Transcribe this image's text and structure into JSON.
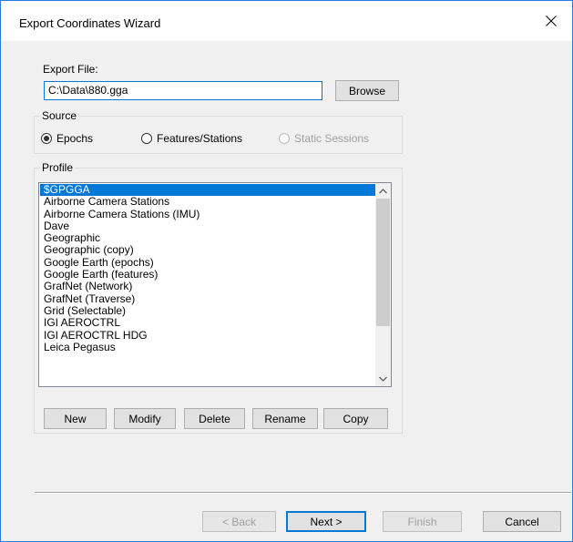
{
  "window": {
    "title": "Export Coordinates Wizard"
  },
  "export_file": {
    "label": "Export File:",
    "value": "C:\\Data\\880.gga",
    "browse_label": "Browse"
  },
  "source": {
    "title": "Source",
    "options": [
      {
        "label": "Epochs",
        "checked": true,
        "enabled": true
      },
      {
        "label": "Features/Stations",
        "checked": false,
        "enabled": true
      },
      {
        "label": "Static Sessions",
        "checked": false,
        "enabled": false
      }
    ]
  },
  "profile": {
    "title": "Profile",
    "items": [
      "$GPGGA",
      "Airborne Camera Stations",
      "Airborne Camera Stations (IMU)",
      "Dave",
      "Geographic",
      "Geographic (copy)",
      "Google Earth (epochs)",
      "Google Earth (features)",
      "GrafNet (Network)",
      "GrafNet (Traverse)",
      "Grid (Selectable)",
      "IGI AEROCTRL",
      "IGI AEROCTRL HDG",
      "Leica Pegasus"
    ],
    "selected_index": 0,
    "buttons": {
      "new": "New",
      "modify": "Modify",
      "delete": "Delete",
      "rename": "Rename",
      "copy": "Copy"
    }
  },
  "footer": {
    "back": "< Back",
    "next": "Next >",
    "finish": "Finish",
    "cancel": "Cancel"
  },
  "colors": {
    "accent": "#0078d7",
    "border": "#2b79d8"
  },
  "icons": {
    "close": "close-icon",
    "scroll_up": "chevron-up-icon",
    "scroll_down": "chevron-down-icon"
  }
}
